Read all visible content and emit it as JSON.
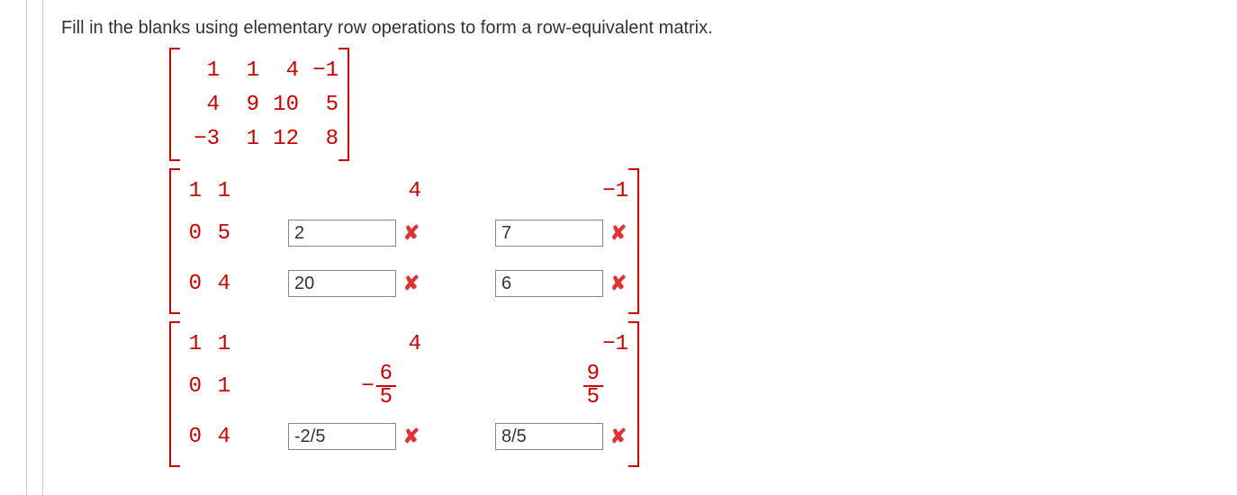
{
  "prompt": "Fill in the blanks using elementary row operations to form a row-equivalent matrix.",
  "m1": {
    "rows": [
      [
        "1",
        "1",
        "4",
        "−1"
      ],
      [
        "4",
        "9",
        "10",
        "5"
      ],
      [
        "−3",
        "1",
        "12",
        "8"
      ]
    ]
  },
  "m2": {
    "r1": {
      "a": "1",
      "b": "1",
      "c": "4",
      "d": "−1"
    },
    "r2": {
      "a": "0",
      "b": "5",
      "c_input": "2",
      "d_input": "7"
    },
    "r3": {
      "a": "0",
      "b": "4",
      "c_input": "20",
      "d_input": "6"
    }
  },
  "m3": {
    "r1": {
      "a": "1",
      "b": "1",
      "c": "4",
      "d": "−1"
    },
    "r2": {
      "a": "0",
      "b": "1",
      "c_sign": "−",
      "c_num": "6",
      "c_den": "5",
      "d_num": "9",
      "d_den": "5"
    },
    "r3": {
      "a": "0",
      "b": "4",
      "c_input": "-2/5",
      "d_input": "8/5"
    }
  },
  "mark": "✘"
}
